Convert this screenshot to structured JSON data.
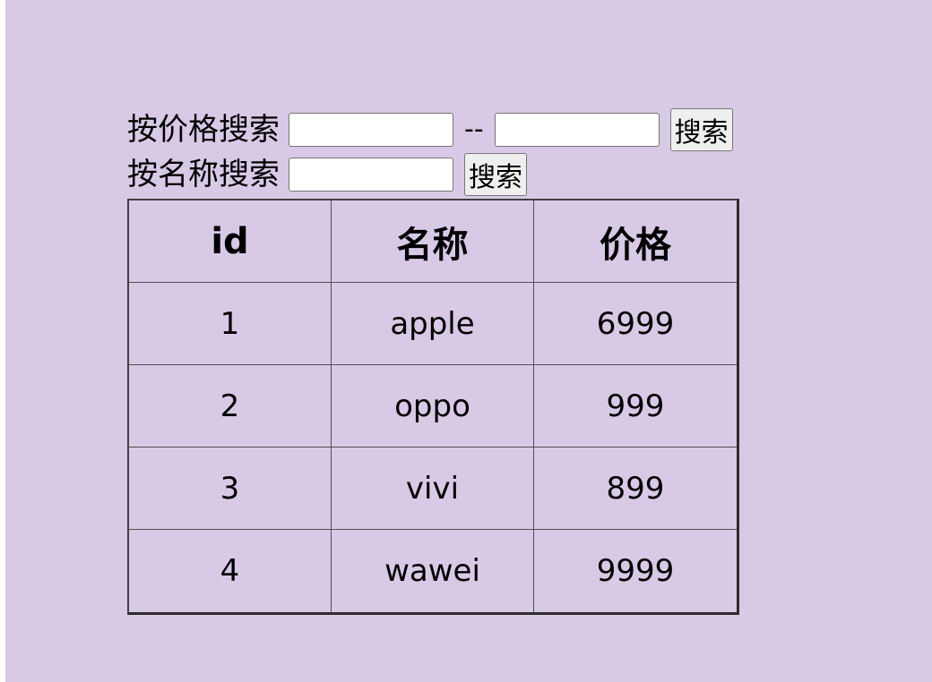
{
  "price_search": {
    "label": "按价格搜索",
    "min_value": "",
    "separator": "--",
    "max_value": "",
    "button_label": "搜索"
  },
  "name_search": {
    "label": "按名称搜索",
    "value": "",
    "button_label": "搜索"
  },
  "table": {
    "headers": [
      "id",
      "名称",
      "价格"
    ],
    "rows": [
      [
        "1",
        "apple",
        "6999"
      ],
      [
        "2",
        "oppo",
        "999"
      ],
      [
        "3",
        "vivi",
        "899"
      ],
      [
        "4",
        "wawei",
        "9999"
      ]
    ]
  },
  "colors": {
    "background": "#d8cae6",
    "border": "#404040"
  }
}
